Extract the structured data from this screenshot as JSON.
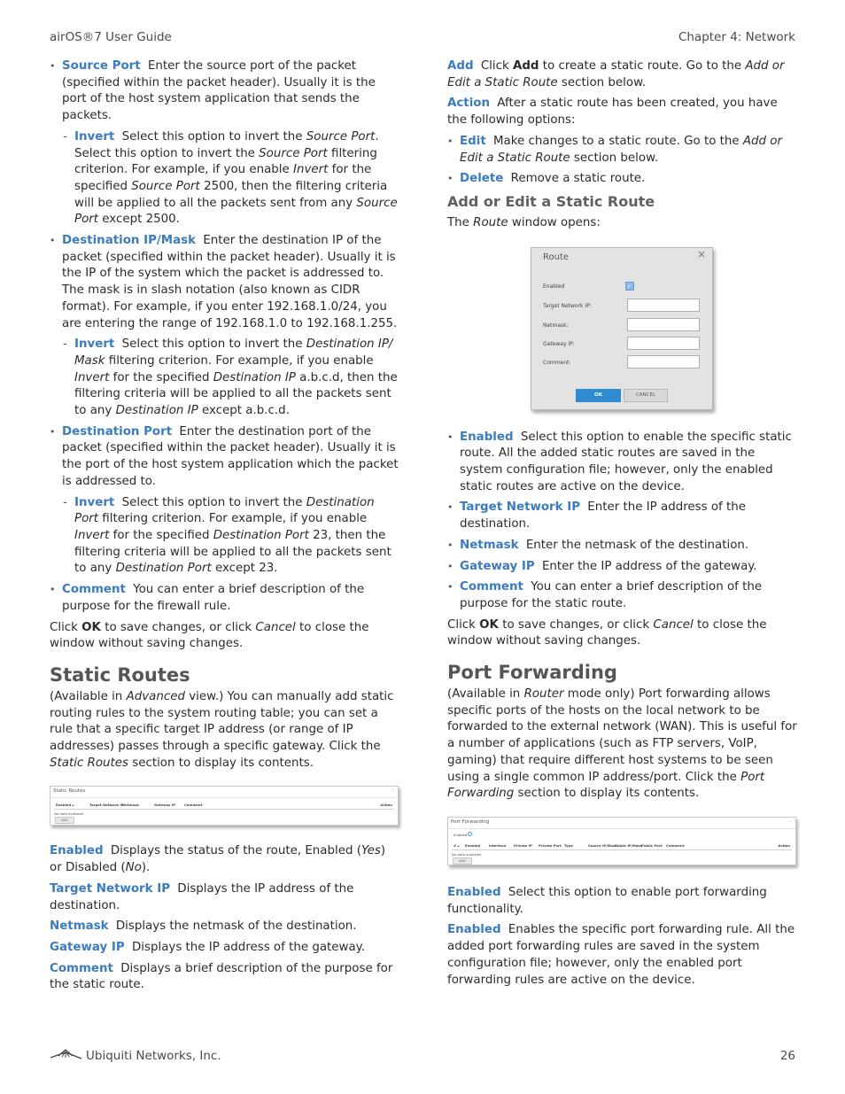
{
  "header": {
    "left": "airOS®7 User Guide",
    "right": "Chapter 4: Network"
  },
  "left_column": {
    "source_port": {
      "term": "Source Port",
      "text": "Enter the source port of the packet (specified within the packet header). Usually it is the port of the host system application that sends the packets.",
      "invert": {
        "term": "Invert",
        "t1": "Select this option to invert the ",
        "i1": "Source Port",
        "t2": ". Select this option to invert the ",
        "i2": "Source Port",
        "t3": " filtering criterion. For example, if you enable ",
        "i3": "Invert",
        "t4": " for the specified ",
        "i4": "Source Port",
        "t5": " 2500, then the filtering criteria will be applied to all the packets sent from any ",
        "i5": "Source Port",
        "t6": " except 2500."
      }
    },
    "dest_ip": {
      "term": "Destination IP/Mask",
      "text": "Enter the destination IP of the packet (specified within the packet header). Usually it is the IP of the system which the packet is addressed to. The mask is in slash notation (also known as CIDR format). For example, if you enter 192.168.1.0/24, you are entering the range of 192.168.1.0 to 192.168.1.255.",
      "invert": {
        "term": "Invert",
        "t1": "Select this option to invert the ",
        "i1": "Destination IP/ Mask",
        "t2": " filtering criterion. For example, if you enable ",
        "i2": "Invert",
        "t3": " for the specified ",
        "i3": "Destination IP",
        "t4": " a.b.c.d, then the filtering criteria will be applied to all the packets sent to any ",
        "i4": "Destination IP",
        "t5": " except a.b.c.d."
      }
    },
    "dest_port": {
      "term": "Destination Port",
      "text": "Enter the destination port of the packet (specified within the packet header). Usually it is the port of the host system application which the packet is addressed to.",
      "invert": {
        "term": "Invert",
        "t1": "Select this option to invert the ",
        "i1": "Destination Port",
        "t2": " filtering criterion. For example, if you enable ",
        "i2": "Invert",
        "t3": " for the specified ",
        "i3": "Destination Port",
        "t4": " 23, then the filtering criteria will be applied to all the packets sent to any ",
        "i4": "Destination Port",
        "t5": " except 23."
      }
    },
    "comment": {
      "term": "Comment",
      "text": "You can enter a brief description of the purpose for the firewall rule."
    },
    "click_ok": {
      "t1": "Click ",
      "b1": "OK",
      "t2": " to save changes, or click ",
      "i1": "Cancel",
      "t3": " to close the window without saving changes."
    },
    "static_routes": {
      "heading": "Static Routes",
      "intro_t1": "(Available in ",
      "intro_i1": "Advanced",
      "intro_t2": " view.) You can manually add static routing rules to the system routing table; you can set a rule that a specific target IP address (or range of IP addresses) passes through a specific gateway. Click the ",
      "intro_i2": "Static Routes",
      "intro_t3": " section to display its contents.",
      "panel": {
        "title": "Static Routes",
        "columns": [
          "Enabled ▴",
          "Target Network IP",
          "Netmask",
          "Gateway IP",
          "Comment",
          "Action"
        ],
        "empty": "No data available",
        "add_button": "ADD"
      },
      "fields": [
        {
          "term": "Enabled",
          "t1": "Displays the status of the route, Enabled (",
          "i1": "Yes",
          "t2": ") or Disabled (",
          "i2": "No",
          "t3": ")."
        },
        {
          "term": "Target Network IP",
          "text": "Displays the IP address of the destination."
        },
        {
          "term": "Netmask",
          "text": "Displays the netmask of the destination."
        },
        {
          "term": "Gateway IP",
          "text": "Displays the IP address of the gateway."
        },
        {
          "term": "Comment",
          "text": "Displays a brief description of the purpose for the static route."
        }
      ]
    }
  },
  "right_column": {
    "add": {
      "term": "Add",
      "t1": "Click ",
      "b1": "Add",
      "t2": " to create a static route. Go to the ",
      "i1": "Add or Edit a Static Route",
      "t3": " section below."
    },
    "action": {
      "term": "Action",
      "text": "After a static route has been created, you have the following options:"
    },
    "edit": {
      "term": "Edit",
      "t1": "Make changes to a static route. Go to the ",
      "i1": "Add or Edit a Static Route",
      "t2": " section below."
    },
    "delete": {
      "term": "Delete",
      "text": "Remove a static route."
    },
    "add_edit_heading": "Add or Edit a Static Route",
    "route_opens": {
      "t1": "The ",
      "i1": "Route",
      "t2": " window opens:"
    },
    "route_dialog": {
      "title": "Route",
      "close": "×",
      "enabled_label": "Enabled",
      "enabled_checked": true,
      "target_label": "Target Network IP:",
      "netmask_label": "Netmask:",
      "gateway_label": "Gateway IP:",
      "comment_label": "Comment:",
      "target_value": "",
      "netmask_value": "",
      "gateway_value": "",
      "comment_value": "",
      "ok": "OK",
      "cancel": "CANCEL"
    },
    "route_fields": [
      {
        "term": "Enabled",
        "text": "Select this option to enable the specific static route. All the added static routes are saved in the system configuration file; however, only the enabled static routes are active on the device."
      },
      {
        "term": "Target Network IP",
        "text": "Enter the IP address of the destination."
      },
      {
        "term": "Netmask",
        "text": "Enter the netmask of the destination."
      },
      {
        "term": "Gateway IP",
        "text": "Enter the IP address of the gateway."
      },
      {
        "term": "Comment",
        "text": "You can enter a brief description of the purpose for the static route."
      }
    ],
    "click_ok": {
      "t1": "Click ",
      "b1": "OK",
      "t2": " to save changes, or click ",
      "i1": "Cancel",
      "t3": " to close the window without saving changes."
    },
    "port_forwarding": {
      "heading": "Port Forwarding",
      "intro_t1": "(Available in ",
      "intro_i1": "Router",
      "intro_t2": " mode only) Port forwarding allows specific ports of the hosts on the local network to be forwarded to the external network (WAN). This is useful for a number of applications (such as FTP servers, VoIP, gaming) that require different host systems to be seen using a single common IP address/port. Click the ",
      "intro_i2": "Port Forwarding",
      "intro_t3": " section to display its contents.",
      "panel": {
        "title": "Port Forwarding",
        "enabled_label": "Enabled",
        "columns": [
          "# ▴",
          "Enabled",
          "Interface",
          "Private IP",
          "Private Port",
          "Type",
          "Source IP/Mask",
          "Public IP/Mask",
          "Public Port",
          "Comment",
          "Action"
        ],
        "empty": "No data available",
        "add_button": "ADD"
      },
      "fields": [
        {
          "term": "Enabled",
          "text": "Select this option to enable port forwarding functionality."
        },
        {
          "term": "Enabled",
          "text": "Enables the specific port forwarding rule. All the added port forwarding rules are saved in the system configuration file; however, only the enabled port forwarding rules are active on the device."
        }
      ]
    }
  },
  "footer": {
    "company": "Ubiquiti Networks, Inc.",
    "page_number": "26"
  },
  "colors": {
    "term_blue": "#3b7bc0",
    "heading_gray": "#555558",
    "ok_button": "#2f8bd2"
  }
}
